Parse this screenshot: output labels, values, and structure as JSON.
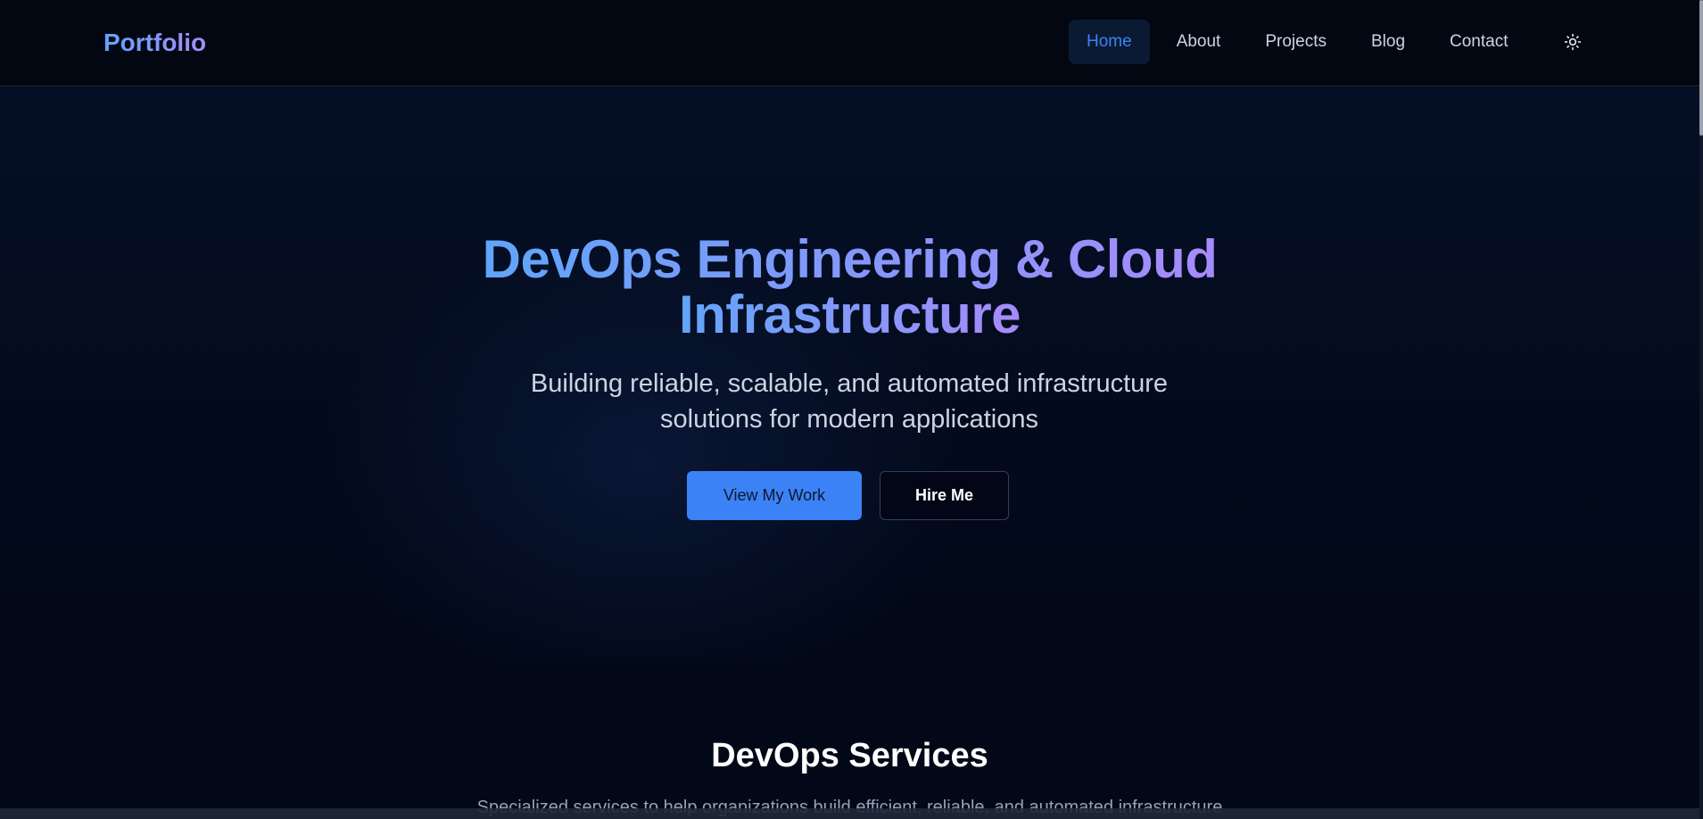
{
  "header": {
    "logo": "Portfolio",
    "nav": [
      {
        "label": "Home",
        "active": true
      },
      {
        "label": "About",
        "active": false
      },
      {
        "label": "Projects",
        "active": false
      },
      {
        "label": "Blog",
        "active": false
      },
      {
        "label": "Contact",
        "active": false
      }
    ],
    "theme_icon": "sun-icon"
  },
  "hero": {
    "title_line1": "DevOps Engineering & Cloud",
    "title_line2": "Infrastructure",
    "subtitle_line1": "Building reliable, scalable, and automated infrastructure",
    "subtitle_line2": "solutions for modern applications",
    "primary_button": "View My Work",
    "secondary_button": "Hire Me"
  },
  "services": {
    "title": "DevOps Services",
    "subtitle": "Specialized services to help organizations build efficient, reliable, and automated infrastructure"
  },
  "colors": {
    "background": "#020817",
    "accent": "#3b82f6",
    "gradient_start": "#60a5fa",
    "gradient_end": "#a78bfa"
  }
}
